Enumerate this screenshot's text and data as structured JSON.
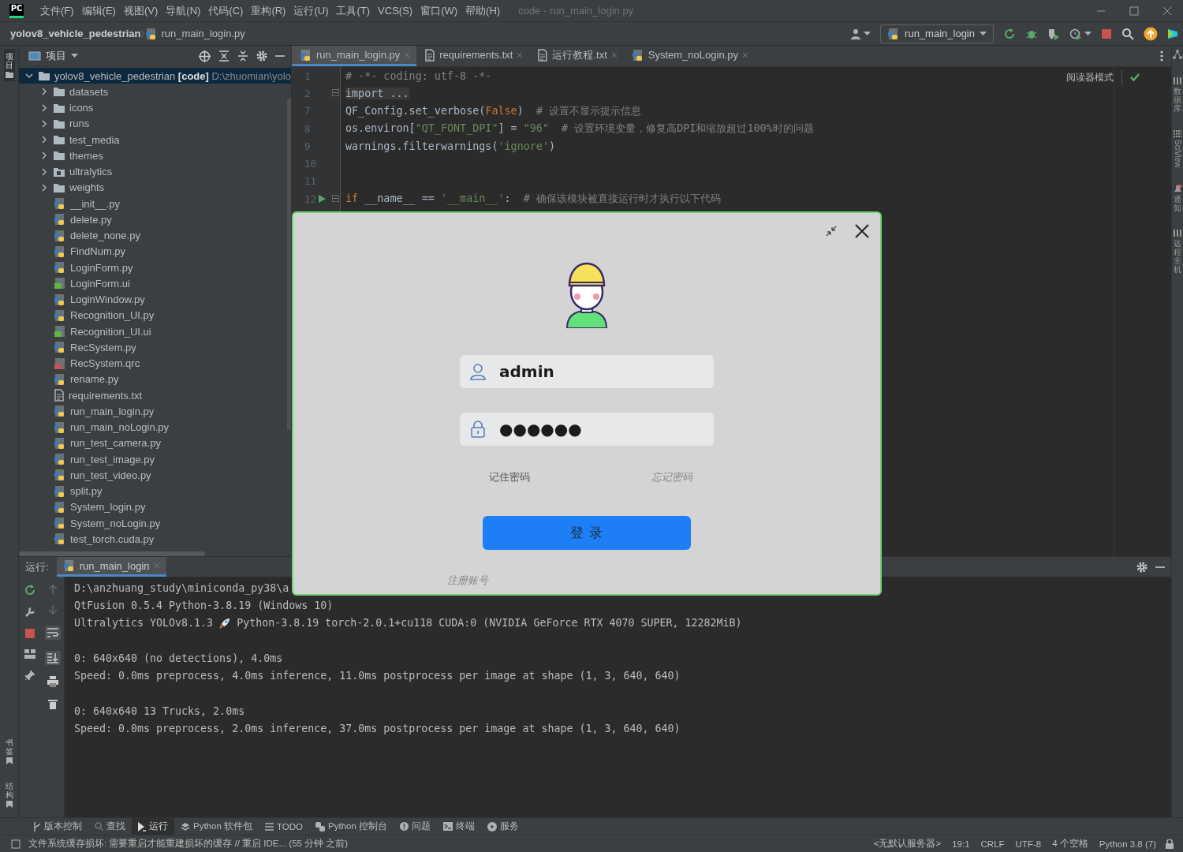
{
  "title_bar": {
    "logo": "PC",
    "menu": [
      "文件(F)",
      "编辑(E)",
      "视图(V)",
      "导航(N)",
      "代码(C)",
      "重构(R)",
      "运行(U)",
      "工具(T)",
      "VCS(S)",
      "窗口(W)",
      "帮助(H)"
    ],
    "title": "code - run_main_login.py"
  },
  "nav_bar": {
    "breadcrumb": [
      "yolov8_vehicle_pedestrian",
      "run_main_login.py"
    ],
    "run_config": "run_main_login"
  },
  "left_stripe": {
    "top": [
      {
        "label": "项目",
        "selected": true
      }
    ],
    "bottom": [
      {
        "label": "书签",
        "selected": false
      },
      {
        "label": "结构",
        "selected": false
      }
    ]
  },
  "right_stripe": [
    {
      "label": "数据库",
      "kind": "cjk"
    },
    {
      "label": "SciView",
      "kind": "latin"
    },
    {
      "label": "通知",
      "kind": "cjk"
    },
    {
      "label": "远程主机",
      "kind": "cjk"
    }
  ],
  "project": {
    "title": "项目",
    "tree": {
      "name": "yolov8_vehicle_pedestrian",
      "tag": "[code]",
      "path": "D:\\zhuomian\\yolo",
      "expanded": true,
      "children": [
        {
          "name": "datasets",
          "kind": "folder",
          "expanded": false
        },
        {
          "name": "icons",
          "kind": "folder",
          "expanded": false
        },
        {
          "name": "runs",
          "kind": "folder",
          "expanded": false
        },
        {
          "name": "test_media",
          "kind": "folder",
          "expanded": false
        },
        {
          "name": "themes",
          "kind": "folder",
          "expanded": false
        },
        {
          "name": "ultralytics",
          "kind": "package",
          "expanded": false
        },
        {
          "name": "weights",
          "kind": "folder",
          "expanded": false
        },
        {
          "name": "__init__.py",
          "kind": "py"
        },
        {
          "name": "delete.py",
          "kind": "py"
        },
        {
          "name": "delete_none.py",
          "kind": "py"
        },
        {
          "name": "FindNum.py",
          "kind": "py"
        },
        {
          "name": "LoginForm.py",
          "kind": "py"
        },
        {
          "name": "LoginForm.ui",
          "kind": "ui"
        },
        {
          "name": "LoginWindow.py",
          "kind": "py"
        },
        {
          "name": "Recognition_UI.py",
          "kind": "py"
        },
        {
          "name": "Recognition_UI.ui",
          "kind": "ui"
        },
        {
          "name": "RecSystem.py",
          "kind": "py"
        },
        {
          "name": "RecSystem.qrc",
          "kind": "qrc"
        },
        {
          "name": "rename.py",
          "kind": "py"
        },
        {
          "name": "requirements.txt",
          "kind": "txt"
        },
        {
          "name": "run_main_login.py",
          "kind": "py"
        },
        {
          "name": "run_main_noLogin.py",
          "kind": "py"
        },
        {
          "name": "run_test_camera.py",
          "kind": "py"
        },
        {
          "name": "run_test_image.py",
          "kind": "py"
        },
        {
          "name": "run_test_video.py",
          "kind": "py"
        },
        {
          "name": "split.py",
          "kind": "py"
        },
        {
          "name": "System_login.py",
          "kind": "py"
        },
        {
          "name": "System_noLogin.py",
          "kind": "py"
        },
        {
          "name": "test_torch.cuda.py",
          "kind": "py"
        }
      ]
    }
  },
  "editor": {
    "tabs": [
      {
        "label": "run_main_login.py",
        "kind": "py",
        "selected": true
      },
      {
        "label": "requirements.txt",
        "kind": "txt",
        "selected": false
      },
      {
        "label": "运行教程.txt",
        "kind": "txt",
        "selected": false
      },
      {
        "label": "System_noLogin.py",
        "kind": "py",
        "selected": false
      }
    ],
    "reader_mode": "阅读器模式",
    "lines": [
      {
        "num": "1",
        "tokens": [
          {
            "kind": "comment",
            "text": "# -*- coding: utf-8 -*-"
          }
        ]
      },
      {
        "num": "2",
        "fold": true,
        "tokens": [
          {
            "kind": "folded",
            "text": "import ..."
          }
        ]
      },
      {
        "num": "7",
        "tokens": [
          {
            "kind": "plain",
            "text": "QF_Config.set_verbose("
          },
          {
            "kind": "keyword",
            "text": "False"
          },
          {
            "kind": "plain",
            "text": ")  "
          },
          {
            "kind": "comment",
            "text": "# 设置不显示提示信息"
          }
        ]
      },
      {
        "num": "8",
        "tokens": [
          {
            "kind": "plain",
            "text": "os.environ["
          },
          {
            "kind": "string",
            "text": "\"QT_FONT_DPI\""
          },
          {
            "kind": "plain",
            "text": "] = "
          },
          {
            "kind": "string",
            "text": "\"96\""
          },
          {
            "kind": "comment",
            "text": "  # 设置环境变量，修复高DPI和缩放超过100%时的问题"
          }
        ]
      },
      {
        "num": "9",
        "tokens": [
          {
            "kind": "plain",
            "text": "warnings.filterwarnings("
          },
          {
            "kind": "string",
            "text": "'ignore'"
          },
          {
            "kind": "plain",
            "text": ")"
          }
        ]
      },
      {
        "num": "10"
      },
      {
        "num": "11"
      },
      {
        "num": "12",
        "run": true,
        "fold": true,
        "tokens": [
          {
            "kind": "keyword",
            "text": "if"
          },
          {
            "kind": "plain",
            "text": " __name__ == "
          },
          {
            "kind": "string",
            "text": "'__main__'"
          },
          {
            "kind": "plain",
            "text": ":  "
          },
          {
            "kind": "comment",
            "text": "# 确保该模块被直接运行时才执行以下代码"
          }
        ]
      }
    ]
  },
  "run_panel": {
    "label": "运行:",
    "tab": "run_main_login",
    "blocks": [
      [
        {
          "text": "D:\\anzhuang_study\\miniconda_py38\\a"
        },
        {
          "text": "QtFusion 0.5.4 Python-3.8.19 (Windows 10)"
        },
        {
          "text": "Ultralytics YOLOv8.1.3",
          "after_rocket": "Python-3.8.19 torch-2.0.1+cu118 CUDA:0 (NVIDIA GeForce RTX 4070 SUPER, 12282MiB)"
        }
      ],
      [
        {
          "text": "0: 640x640 (no detections), 4.0ms"
        },
        {
          "text": "Speed: 0.0ms preprocess, 4.0ms inference, 11.0ms postprocess per image at shape (1, 3, 640, 640)"
        }
      ],
      [
        {
          "text": "0: 640x640 13 Trucks, 2.0ms"
        },
        {
          "text": "Speed: 0.0ms preprocess, 2.0ms inference, 37.0ms postprocess per image at shape (1, 3, 640, 640)"
        }
      ]
    ]
  },
  "login_dialog": {
    "username": "admin",
    "password": "●●●●●●",
    "remember": "记住密码",
    "forgot": "忘记密码",
    "login": "登 录",
    "register": "注册账号"
  },
  "tool_tabs": [
    {
      "label": "版本控制",
      "kind": "branch",
      "selected": false
    },
    {
      "label": "查找",
      "kind": "search",
      "selected": false
    },
    {
      "label": "运行",
      "kind": "run",
      "selected": true
    },
    {
      "label": "Python 软件包",
      "kind": "layers",
      "selected": false
    },
    {
      "label": "TODO",
      "kind": "list",
      "selected": false
    },
    {
      "label": "Python 控制台",
      "kind": "console",
      "selected": false
    },
    {
      "label": "问题",
      "kind": "problem",
      "selected": false
    },
    {
      "label": "终端",
      "kind": "terminal",
      "selected": false
    },
    {
      "label": "服务",
      "kind": "service",
      "selected": false
    }
  ],
  "status_bar": {
    "message": "文件系统缓存损坏: 需要重启才能重建损坏的缓存 // 重启 IDE... (55 分钟 之前)",
    "items": [
      "<无默认服务器>",
      "19:1",
      "CRLF",
      "UTF-8",
      "4 个空格",
      "Python 3.8 (7)"
    ]
  }
}
